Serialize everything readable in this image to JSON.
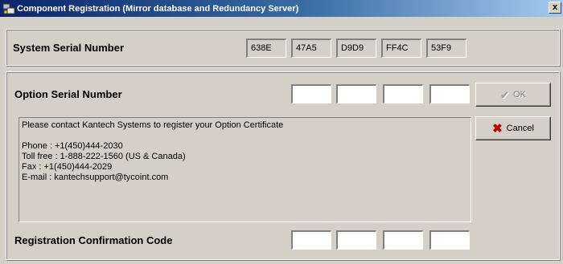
{
  "window": {
    "title": "Component Registration (Mirror database and Redundancy Server)",
    "close_label": "x"
  },
  "system_serial": {
    "label": "System Serial Number",
    "parts": [
      "638E",
      "47A5",
      "D9D9",
      "FF4C",
      "53F9"
    ]
  },
  "option_serial": {
    "label": "Option Serial Number",
    "parts": [
      "",
      "",
      "",
      ""
    ]
  },
  "message": {
    "line1": "Please contact Kantech Systems to register your Option Certificate",
    "phone": "Phone : +1(450)444-2030",
    "tollfree": "Toll free : 1-888-222-1560 (US & Canada)",
    "fax": "Fax : +1(450)444-2029",
    "email": "E-mail : kantechsupport@tycoint.com"
  },
  "confirmation": {
    "label": "Registration Confirmation Code",
    "parts": [
      "",
      "",
      "",
      ""
    ]
  },
  "buttons": {
    "ok_label": "OK",
    "cancel_label": "Cancel"
  },
  "icons": {
    "app": "component-registration-icon",
    "ok": "checkmark-icon",
    "cancel": "red-x-icon"
  }
}
